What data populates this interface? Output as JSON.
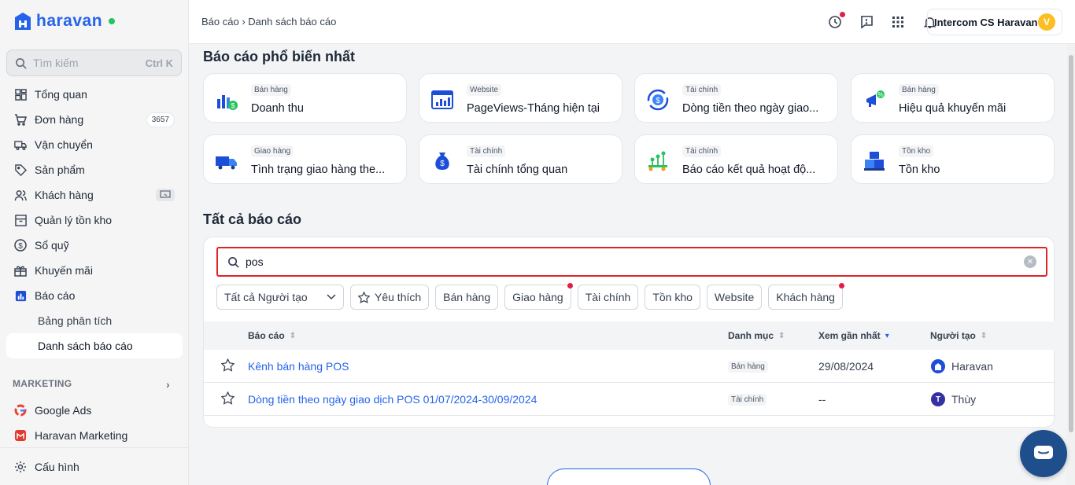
{
  "sidebar": {
    "logo_text": "haravan",
    "search": {
      "placeholder": "Tìm kiếm",
      "shortcut": "Ctrl K"
    },
    "items": [
      {
        "label": "Tổng quan"
      },
      {
        "label": "Đơn hàng",
        "badge": "3657"
      },
      {
        "label": "Vận chuyển"
      },
      {
        "label": "Sản phẩm"
      },
      {
        "label": "Khách hàng"
      },
      {
        "label": "Quản lý tồn kho"
      },
      {
        "label": "Sổ quỹ"
      },
      {
        "label": "Khuyến mãi"
      },
      {
        "label": "Báo cáo"
      }
    ],
    "sub_items": [
      {
        "label": "Bảng phân tích"
      },
      {
        "label": "Danh sách báo cáo"
      }
    ],
    "section_marketing": "MARKETING",
    "marketing_items": [
      {
        "label": "Google Ads"
      },
      {
        "label": "Haravan Marketing"
      }
    ],
    "settings_label": "Cấu hình"
  },
  "header": {
    "breadcrumb_parent": "Báo cáo",
    "breadcrumb_current": "Danh sách báo cáo",
    "user_name": "Intercom CS Haravan",
    "user_initial": "V"
  },
  "popular": {
    "title": "Báo cáo phổ biến nhất",
    "cards": [
      {
        "tag": "Bán hàng",
        "title": "Doanh thu"
      },
      {
        "tag": "Website",
        "title": "PageViews-Tháng hiện tại"
      },
      {
        "tag": "Tài chính",
        "title": "Dòng tiền theo ngày giao..."
      },
      {
        "tag": "Bán hàng",
        "title": "Hiệu quả khuyến mãi"
      },
      {
        "tag": "Giao hàng",
        "title": "Tình trạng giao hàng the..."
      },
      {
        "tag": "Tài chính",
        "title": "Tài chính tổng quan"
      },
      {
        "tag": "Tài chính",
        "title": "Báo cáo kết quả hoạt độ..."
      },
      {
        "tag": "Tồn kho",
        "title": "Tồn kho"
      }
    ]
  },
  "all_reports": {
    "title": "Tất cả báo cáo",
    "search_value": "pos",
    "creator_filter": "Tất cả Người tạo",
    "filters": [
      "Yêu thích",
      "Bán hàng",
      "Giao hàng",
      "Tài chính",
      "Tồn kho",
      "Website",
      "Khách hàng"
    ],
    "columns": {
      "report": "Báo cáo",
      "category": "Danh mục",
      "last_viewed": "Xem gần nhất",
      "creator": "Người tạo"
    },
    "rows": [
      {
        "name": "Kênh bán hàng POS",
        "category": "Bán hàng",
        "last_viewed": "29/08/2024",
        "creator": "Haravan",
        "creator_initial": ""
      },
      {
        "name": "Dòng tiền theo ngày giao dịch POS 01/07/2024-30/09/2024",
        "category": "Tài chính",
        "last_viewed": "--",
        "creator": "Thùy",
        "creator_initial": "T"
      }
    ]
  },
  "colors": {
    "brand": "#2563eb",
    "highlight": "#dc2626",
    "chat": "#1f4e8c"
  }
}
